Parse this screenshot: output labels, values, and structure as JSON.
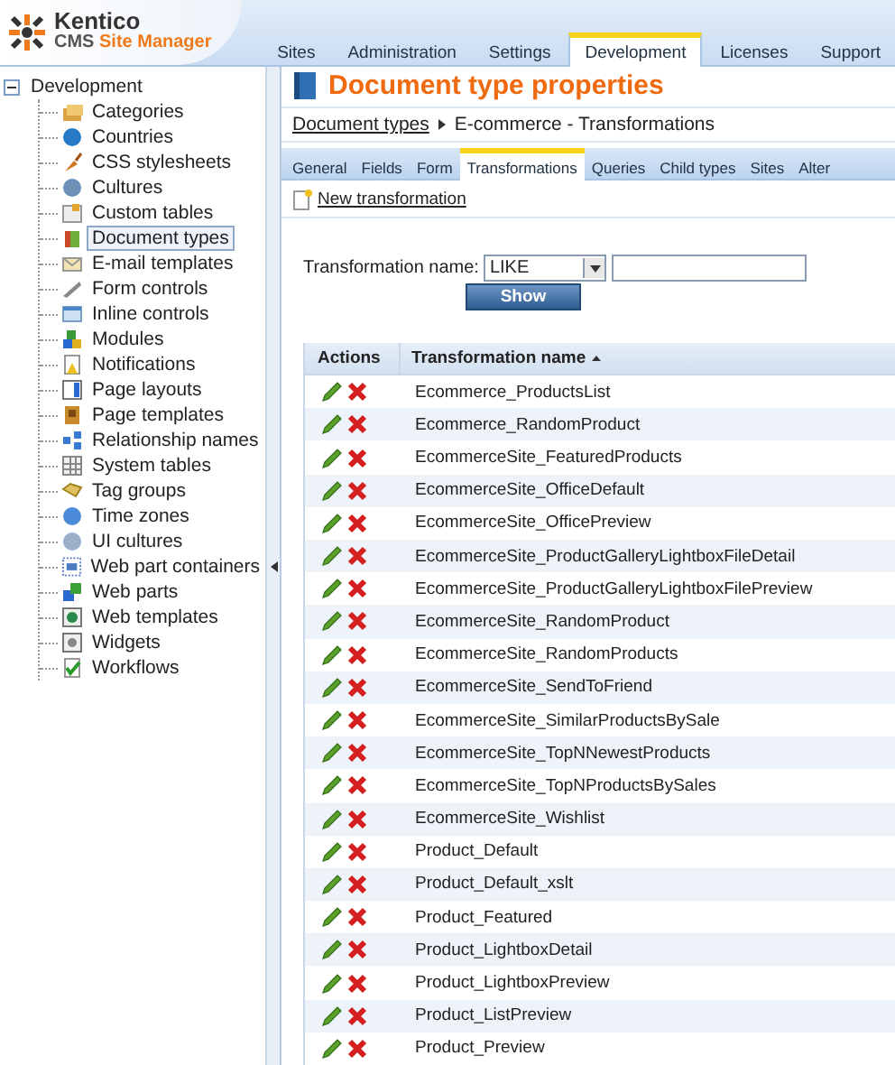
{
  "logo": {
    "brand": "Kentico",
    "product_prefix": "CMS ",
    "product": "Site Manager"
  },
  "main_tabs": [
    {
      "label": "Sites",
      "selected": false
    },
    {
      "label": "Administration",
      "selected": false
    },
    {
      "label": "Settings",
      "selected": false
    },
    {
      "label": "Development",
      "selected": true
    },
    {
      "label": "Licenses",
      "selected": false
    },
    {
      "label": "Support",
      "selected": false
    }
  ],
  "tree": {
    "label": "Development",
    "expanded": true,
    "children": [
      {
        "label": "Categories",
        "selected": false
      },
      {
        "label": "Countries",
        "selected": false
      },
      {
        "label": "CSS stylesheets",
        "selected": false
      },
      {
        "label": "Cultures",
        "selected": false
      },
      {
        "label": "Custom tables",
        "selected": false
      },
      {
        "label": "Document types",
        "selected": true
      },
      {
        "label": "E-mail templates",
        "selected": false
      },
      {
        "label": "Form controls",
        "selected": false
      },
      {
        "label": "Inline controls",
        "selected": false
      },
      {
        "label": "Modules",
        "selected": false
      },
      {
        "label": "Notifications",
        "selected": false
      },
      {
        "label": "Page layouts",
        "selected": false
      },
      {
        "label": "Page templates",
        "selected": false
      },
      {
        "label": "Relationship names",
        "selected": false
      },
      {
        "label": "System tables",
        "selected": false
      },
      {
        "label": "Tag groups",
        "selected": false
      },
      {
        "label": "Time zones",
        "selected": false
      },
      {
        "label": "UI cultures",
        "selected": false
      },
      {
        "label": "Web part containers",
        "selected": false
      },
      {
        "label": "Web parts",
        "selected": false
      },
      {
        "label": "Web templates",
        "selected": false
      },
      {
        "label": "Widgets",
        "selected": false
      },
      {
        "label": "Workflows",
        "selected": false
      }
    ]
  },
  "page_title": "Document type properties",
  "breadcrumb": {
    "link": "Document types",
    "current": "E-commerce - Transformations"
  },
  "sub_tabs": [
    {
      "label": "General",
      "selected": false
    },
    {
      "label": "Fields",
      "selected": false
    },
    {
      "label": "Form",
      "selected": false
    },
    {
      "label": "Transformations",
      "selected": true
    },
    {
      "label": "Queries",
      "selected": false
    },
    {
      "label": "Child types",
      "selected": false
    },
    {
      "label": "Sites",
      "selected": false
    },
    {
      "label": "Alter",
      "selected": false
    }
  ],
  "new_link": "New transformation",
  "filter": {
    "label": "Transformation name:",
    "operator": "LIKE",
    "button": "Show"
  },
  "table": {
    "columns": [
      "Actions",
      "Transformation name"
    ],
    "rows": [
      "Ecommerce_ProductsList",
      "Ecommerce_RandomProduct",
      "EcommerceSite_FeaturedProducts",
      "EcommerceSite_OfficeDefault",
      "EcommerceSite_OfficePreview",
      "EcommerceSite_ProductGalleryLightboxFileDetail",
      "EcommerceSite_ProductGalleryLightboxFilePreview",
      "EcommerceSite_RandomProduct",
      "EcommerceSite_RandomProducts",
      "EcommerceSite_SendToFriend",
      "EcommerceSite_SimilarProductsBySale",
      "EcommerceSite_TopNNewestProducts",
      "EcommerceSite_TopNProductsBySales",
      "EcommerceSite_Wishlist",
      "Product_Default",
      "Product_Default_xslt",
      "Product_Featured",
      "Product_LightboxDetail",
      "Product_LightboxPreview",
      "Product_ListPreview",
      "Product_Preview"
    ]
  }
}
